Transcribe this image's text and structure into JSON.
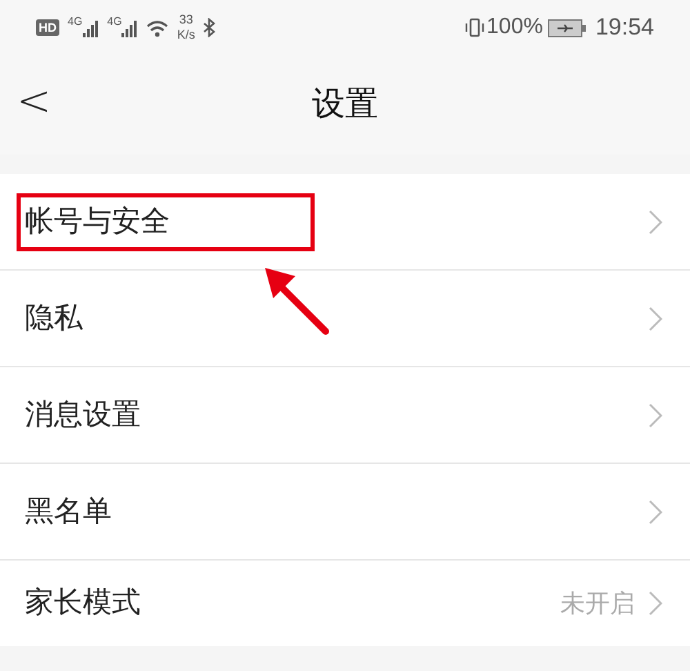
{
  "status_bar": {
    "badge": "HD",
    "networks": [
      "4G",
      "4G"
    ],
    "speed_value": "33",
    "speed_unit": "K/s",
    "battery": "100%",
    "time": "19:54"
  },
  "header": {
    "back": "<",
    "title": "设置"
  },
  "items": [
    {
      "label": "帐号与安全",
      "highlighted": true
    },
    {
      "label": "隐私",
      "highlighted": false
    },
    {
      "label": "消息设置",
      "highlighted": false
    },
    {
      "label": "黑名单",
      "highlighted": false
    },
    {
      "label": "家长模式",
      "value": "未开启",
      "highlighted": false
    }
  ]
}
